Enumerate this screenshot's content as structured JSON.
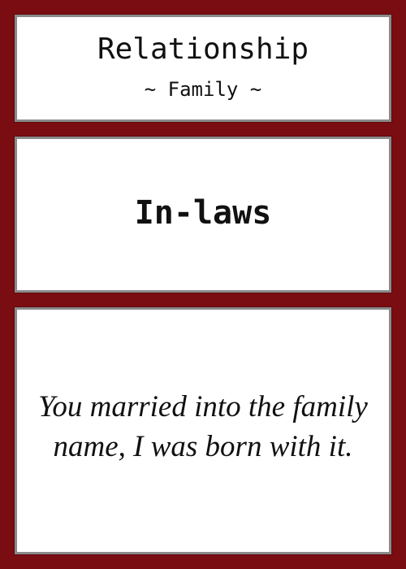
{
  "card": {
    "category": "Relationship",
    "subcategory": "~ Family ~",
    "term": "In-laws",
    "quote": "You married into the family name, I was born with it."
  },
  "colors": {
    "background": "#7a0d12",
    "panel": "#ffffff",
    "panel_border": "#8a8a8a",
    "text": "#111111"
  }
}
